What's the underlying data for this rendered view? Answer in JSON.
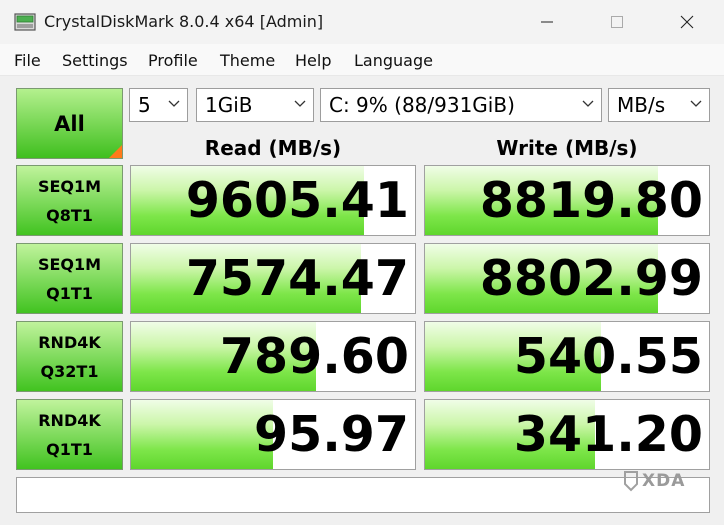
{
  "window": {
    "title": "CrystalDiskMark 8.0.4 x64 [Admin]"
  },
  "menu": [
    "File",
    "Settings",
    "Profile",
    "Theme",
    "Help",
    "Language"
  ],
  "controls": {
    "all_label": "All",
    "count": "5",
    "size": "1GiB",
    "drive": "C: 9% (88/931GiB)",
    "unit": "MB/s"
  },
  "headers": {
    "read": "Read (MB/s)",
    "write": "Write (MB/s)"
  },
  "tests": [
    {
      "line1": "SEQ1M",
      "line2": "Q8T1",
      "read": "9605.41",
      "write": "8819.80",
      "read_fill": 0.82,
      "write_fill": 0.82
    },
    {
      "line1": "SEQ1M",
      "line2": "Q1T1",
      "read": "7574.47",
      "write": "8802.99",
      "read_fill": 0.81,
      "write_fill": 0.82
    },
    {
      "line1": "RND4K",
      "line2": "Q32T1",
      "read": "789.60",
      "write": "540.55",
      "read_fill": 0.65,
      "write_fill": 0.62
    },
    {
      "line1": "RND4K",
      "line2": "Q1T1",
      "read": "95.97",
      "write": "341.20",
      "read_fill": 0.5,
      "write_fill": 0.6
    }
  ],
  "comment": "",
  "watermark": "XDA",
  "colors": {
    "accent_green": "#41c320",
    "corner_orange": "#ff7a1a"
  },
  "icons": {
    "app": "disk-icon",
    "minimize": "minimize-icon",
    "maximize": "maximize-icon",
    "close": "close-icon",
    "dropdown": "chevron-down-icon"
  }
}
